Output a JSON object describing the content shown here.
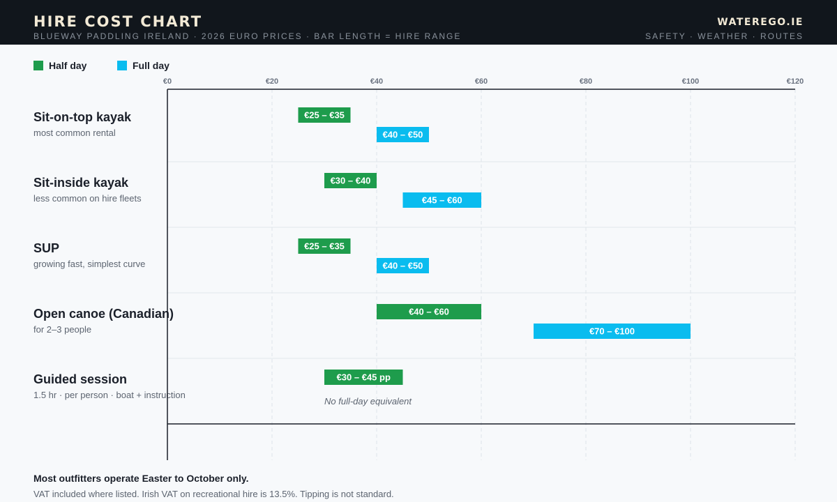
{
  "header": {
    "title": "HIRE COST CHART",
    "subtitle": "BLUEWAY PADDLING IRELAND · 2026 EURO PRICES · BAR LENGTH = HIRE RANGE",
    "brand": "WATEREGO.IE",
    "brand_nav": "SAFETY · WEATHER · ROUTES"
  },
  "legend": [
    {
      "label": "Half day",
      "color": "#1e9c4c"
    },
    {
      "label": "Full day",
      "color": "#0abcef"
    }
  ],
  "colors": {
    "half_day": "#1e9c4c",
    "full_day": "#0abcef",
    "header_bg": "#11161c",
    "page_bg": "#f7f9fb"
  },
  "chart_data": {
    "type": "bar",
    "orientation": "horizontal-range",
    "title": "HIRE COST CHART",
    "xlim": [
      0,
      120
    ],
    "x_ticks": [
      0,
      20,
      40,
      60,
      80,
      100,
      120
    ],
    "x_tick_labels": [
      "€0",
      "€20",
      "€40",
      "€60",
      "€80",
      "€100",
      "€120"
    ],
    "grid": true,
    "legend_position": "top-left",
    "categories": [
      {
        "label": "Sit-on-top kayak",
        "sublabel": "most common rental",
        "half_day": {
          "min": 25,
          "max": 35,
          "label": "€25 – €35"
        },
        "full_day": {
          "min": 40,
          "max": 50,
          "label": "€40 – €50"
        }
      },
      {
        "label": "Sit-inside kayak",
        "sublabel": "less common on hire fleets",
        "half_day": {
          "min": 30,
          "max": 40,
          "label": "€30 – €40"
        },
        "full_day": {
          "min": 45,
          "max": 60,
          "label": "€45 – €60"
        }
      },
      {
        "label": "SUP",
        "sublabel": "growing fast, simplest curve",
        "half_day": {
          "min": 25,
          "max": 35,
          "label": "€25 – €35"
        },
        "full_day": {
          "min": 40,
          "max": 50,
          "label": "€40 – €50"
        }
      },
      {
        "label": "Open canoe (Canadian)",
        "sublabel": "for 2–3 people",
        "half_day": {
          "min": 40,
          "max": 60,
          "label": "€40 – €60"
        },
        "full_day": {
          "min": 70,
          "max": 100,
          "label": "€70 – €100"
        }
      },
      {
        "label": "Guided session",
        "sublabel": "1.5 hr · per person · boat + instruction",
        "half_day": {
          "min": 30,
          "max": 45,
          "label": "€30 – €45 pp"
        },
        "full_day": null,
        "note": "No full-day equivalent"
      }
    ]
  },
  "footer": {
    "main": "Most outfitters operate Easter to October only.",
    "note": "VAT included where listed. Irish VAT on recreational hire is 13.5%. Tipping is not standard."
  }
}
